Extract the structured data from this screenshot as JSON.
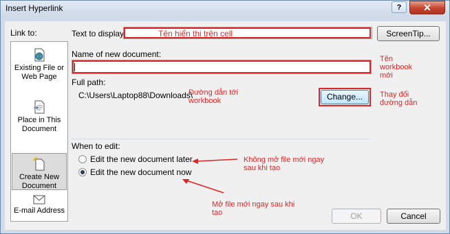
{
  "window": {
    "title": "Insert Hyperlink",
    "help": "?",
    "close": "✕"
  },
  "sidebar": {
    "label": "Link to:",
    "items": [
      {
        "label": "Existing File or Web Page",
        "icon": "globe-file-icon"
      },
      {
        "label": "Place in This Document",
        "icon": "document-place-icon"
      },
      {
        "label": "Create New Document",
        "icon": "new-document-icon",
        "selected": true
      },
      {
        "label": "E-mail Address",
        "icon": "mail-icon"
      }
    ]
  },
  "fields": {
    "text_to_display_label": "Text to display:",
    "text_to_display_value": "",
    "screentip": "ScreenTip...",
    "name_label": "Name of new document:",
    "name_value": "",
    "full_path_label": "Full path:",
    "full_path_value": "C:\\Users\\Laptop88\\Downloads\\",
    "change": "Change...",
    "when_to_edit_label": "When to edit:",
    "edit_later": "Edit the new document later",
    "edit_now": "Edit the new document now",
    "selected_option": "edit_now"
  },
  "annotations": {
    "display_text": "Tên hiển thị trên cell",
    "workbook_name": "Tên workbook mới",
    "path": "Đường dẫn tới workbook",
    "change": "Thay đổi đường dẫn",
    "later": "Không mở file mới ngay sau khi tạo",
    "now": "Mở file mới ngay sau khi tạo"
  },
  "footer": {
    "ok": "OK",
    "cancel": "Cancel"
  },
  "colors": {
    "annotation": "#e02424",
    "client_bg": "#f0f0f0",
    "frame": "#cfdbe8"
  }
}
